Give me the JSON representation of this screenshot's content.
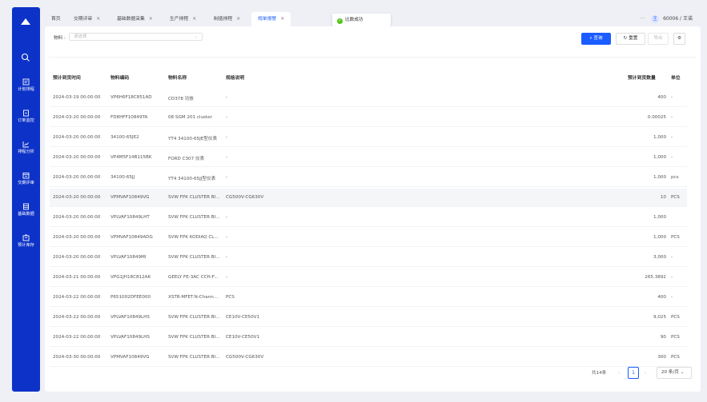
{
  "sidebar": {
    "items": [
      {
        "label": "计划排程",
        "icon": "calendar-icon"
      },
      {
        "label": "订单监控",
        "icon": "monitor-icon"
      },
      {
        "label": "排程分析",
        "icon": "chart-icon"
      },
      {
        "label": "交期评审",
        "icon": "review-icon"
      },
      {
        "label": "基础数据",
        "icon": "database-icon"
      },
      {
        "label": "预计库存",
        "icon": "inventory-icon"
      }
    ]
  },
  "tabs": [
    {
      "label": "首页",
      "closable": false
    },
    {
      "label": "交期评审",
      "closable": true
    },
    {
      "label": "基础数据采集",
      "closable": true
    },
    {
      "label": "生产排程",
      "closable": true
    },
    {
      "label": "制造排程",
      "closable": true
    },
    {
      "label": "规单报警",
      "closable": true,
      "active": true
    }
  ],
  "tab_close": "×",
  "toast": {
    "text": "比数成功"
  },
  "user": {
    "more": "···",
    "avatar": "王",
    "name": "60006 / 王诺"
  },
  "filter": {
    "label": "物料 :",
    "placeholder": "请选择"
  },
  "toolbar": {
    "query": "查询",
    "reset": "重置",
    "export": "导出"
  },
  "table": {
    "headers": [
      "预计到货时间",
      "物料编码",
      "物料名称",
      "规格说明",
      "预计到货数量",
      "单位"
    ],
    "rows": [
      [
        "2024-03-19 00:00:00",
        "VP6H6F18C851AD",
        "CD378 功放",
        "-",
        "400",
        "-"
      ],
      [
        "2024-03-20 00:00:00",
        "FD8HFF10849TA",
        "08 SGM 201 cluster",
        "-",
        "0.00025",
        "-"
      ],
      [
        "2024-03-20 00:00:00",
        "34100-65JE2",
        "YT4 34100-65JE型仪表",
        "-",
        "1,000",
        "-"
      ],
      [
        "2024-03-20 00:00:00",
        "VP4M5F14B115BK",
        "FORD C307 仪表",
        "-",
        "1,000",
        "-"
      ],
      [
        "2024-03-20 00:00:00",
        "34100-65JJ",
        "YT4 34100-65JJ型仪表",
        "-",
        "1,000",
        "pcs"
      ],
      [
        "2024-03-20 00:00:00",
        "VPMVAF10849VG",
        "SVW FPK CLUSTER BI...",
        "CG500V-CG630V",
        "10",
        "PCS"
      ],
      [
        "2024-03-20 00:00:00",
        "VPLVAF10849LHT",
        "SVW FPK CLUSTER BI...",
        "-",
        "1,000",
        ""
      ],
      [
        "2024-03-20 00:00:00",
        "VPMVAF10849ADG",
        "SVW FPK KODIAQ CL...",
        "-",
        "1,000",
        "PCS"
      ],
      [
        "2024-03-20 00:00:00",
        "VPLVAF10849MI",
        "SVW FPK CLUSTER BI...",
        "-",
        "3,000",
        "-"
      ],
      [
        "2024-03-21 00:00:00",
        "VPG1JH18C812AK",
        "GEELY FE-3AC CCH-F...",
        "-",
        "265.3892",
        "-"
      ],
      [
        "2024-03-22 00:00:00",
        "P651002DFEE000",
        "XSTR-MFET.N-Chann...",
        "PCS",
        "400",
        "-"
      ],
      [
        "2024-03-22 00:00:00",
        "VPLVAF10849LHS",
        "SVW FPK CLUSTER BI...",
        "CE10V-CE50V1",
        "9,025",
        "PCS"
      ],
      [
        "2024-03-22 00:00:00",
        "VPLVAF10849LHS",
        "SVW FPK CLUSTER BI...",
        "CE10V-CE50V1",
        "90",
        "PCS"
      ],
      [
        "2024-03-30 00:00:00",
        "VPMVAF10849VG",
        "SVW FPK CLUSTER BI...",
        "CG500V-CG630V",
        "300",
        "PCS"
      ]
    ]
  },
  "pagination": {
    "total": "共14条",
    "prev": "‹",
    "page": "1",
    "next": "›",
    "page_size": "20 条/页"
  }
}
